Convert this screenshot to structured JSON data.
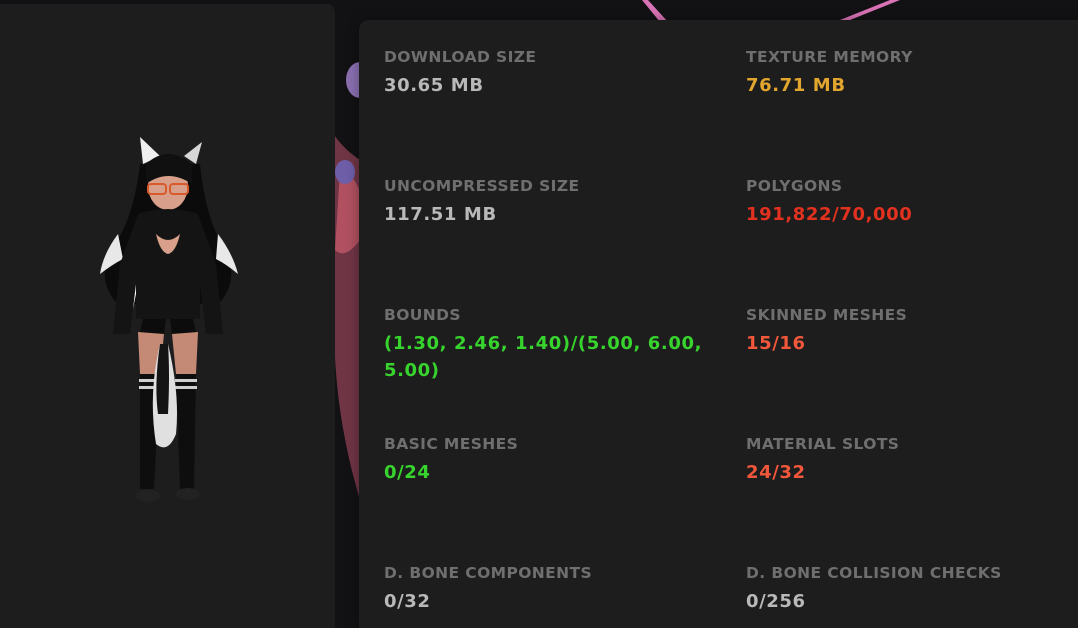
{
  "stats": [
    {
      "label": "DOWNLOAD SIZE",
      "value": "30.65 MB",
      "color": "#b9b9b9"
    },
    {
      "label": "TEXTURE MEMORY",
      "value": "76.71 MB",
      "color": "#e2a62e"
    },
    {
      "label": "UNCOMPRESSED SIZE",
      "value": "117.51 MB",
      "color": "#b9b9b9"
    },
    {
      "label": "POLYGONS",
      "value": "191,822/70,000",
      "color": "#e2321f"
    },
    {
      "label": "BOUNDS",
      "value": "(1.30, 2.46, 1.40)/(5.00, 6.00, 5.00)",
      "color": "#38d42e"
    },
    {
      "label": "SKINNED MESHES",
      "value": "15/16",
      "color": "#f2573b"
    },
    {
      "label": "BASIC MESHES",
      "value": "0/24",
      "color": "#38d42e"
    },
    {
      "label": "MATERIAL SLOTS",
      "value": "24/32",
      "color": "#f2573b"
    },
    {
      "label": "D. BONE COMPONENTS",
      "value": "0/32",
      "color": "#b9b9b9"
    },
    {
      "label": "D. BONE COLLISION CHECKS",
      "value": "0/256",
      "color": "#b9b9b9"
    }
  ]
}
